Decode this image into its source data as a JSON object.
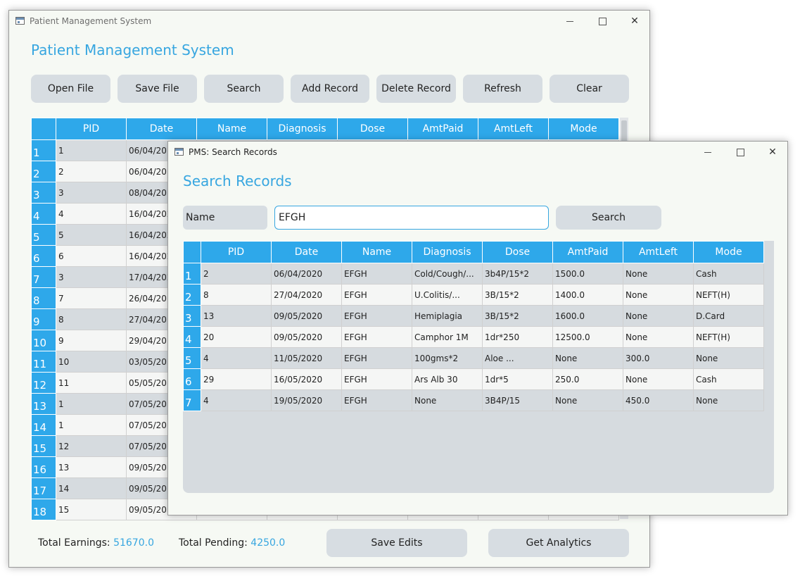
{
  "main_window": {
    "title": "Patient Management System",
    "heading": "Patient Management System",
    "toolbar": [
      "Open File",
      "Save File",
      "Search",
      "Add Record",
      "Delete Record",
      "Refresh",
      "Clear"
    ],
    "columns": [
      "PID",
      "Date",
      "Name",
      "Diagnosis",
      "Dose",
      "AmtPaid",
      "AmtLeft",
      "Mode"
    ],
    "rows": [
      {
        "n": "1",
        "pid": "1",
        "date": "06/04/20"
      },
      {
        "n": "2",
        "pid": "2",
        "date": "06/04/20"
      },
      {
        "n": "3",
        "pid": "3",
        "date": "08/04/20"
      },
      {
        "n": "4",
        "pid": "4",
        "date": "16/04/202"
      },
      {
        "n": "5",
        "pid": "5",
        "date": "16/04/202"
      },
      {
        "n": "6",
        "pid": "6",
        "date": "16/04/202"
      },
      {
        "n": "7",
        "pid": "3",
        "date": "17/04/202"
      },
      {
        "n": "8",
        "pid": "7",
        "date": "26/04/20"
      },
      {
        "n": "9",
        "pid": "8",
        "date": "27/04/20"
      },
      {
        "n": "10",
        "pid": "9",
        "date": "29/04/20"
      },
      {
        "n": "11",
        "pid": "10",
        "date": "03/05/20"
      },
      {
        "n": "12",
        "pid": "11",
        "date": "05/05/20"
      },
      {
        "n": "13",
        "pid": "1",
        "date": "07/05/20"
      },
      {
        "n": "14",
        "pid": "1",
        "date": "07/05/20"
      },
      {
        "n": "15",
        "pid": "12",
        "date": "07/05/20"
      },
      {
        "n": "16",
        "pid": "13",
        "date": "09/05/20"
      },
      {
        "n": "17",
        "pid": "14",
        "date": "09/05/20"
      },
      {
        "n": "18",
        "pid": "15",
        "date": "09/05/20"
      }
    ],
    "footer": {
      "earnings_label": "Total Earnings:",
      "earnings_value": "51670.0",
      "pending_label": "Total Pending:",
      "pending_value": "4250.0",
      "save_edits": "Save Edits",
      "get_analytics": "Get Analytics"
    }
  },
  "search_window": {
    "title": "PMS: Search Records",
    "heading": "Search Records",
    "field_label": "Name",
    "field_value": "EFGH",
    "search_button": "Search",
    "columns": [
      "PID",
      "Date",
      "Name",
      "Diagnosis",
      "Dose",
      "AmtPaid",
      "AmtLeft",
      "Mode"
    ],
    "rows": [
      [
        "1",
        "2",
        "06/04/2020",
        "EFGH",
        "Cold/Cough/...",
        "3b4P/15*2",
        "1500.0",
        "None",
        "Cash"
      ],
      [
        "2",
        "8",
        "27/04/2020",
        "EFGH",
        "U.Colitis/...",
        "3B/15*2",
        "1400.0",
        "None",
        "NEFT(H)"
      ],
      [
        "3",
        "13",
        "09/05/2020",
        "EFGH",
        "Hemiplagia",
        "3B/15*2",
        "1600.0",
        "None",
        "D.Card"
      ],
      [
        "4",
        "20",
        "09/05/2020",
        "EFGH",
        "Camphor 1M",
        "1dr*250",
        "12500.0",
        "None",
        "NEFT(H)"
      ],
      [
        "5",
        "4",
        "11/05/2020",
        "EFGH",
        "100gms*2",
        "Aloe ...",
        "None",
        "300.0",
        "None"
      ],
      [
        "6",
        "29",
        "16/05/2020",
        "EFGH",
        "Ars Alb 30",
        "1dr*5",
        "250.0",
        "None",
        "Cash"
      ],
      [
        "7",
        "4",
        "19/05/2020",
        "EFGH",
        "None",
        "3B4P/15",
        "None",
        "450.0",
        "None"
      ]
    ]
  }
}
